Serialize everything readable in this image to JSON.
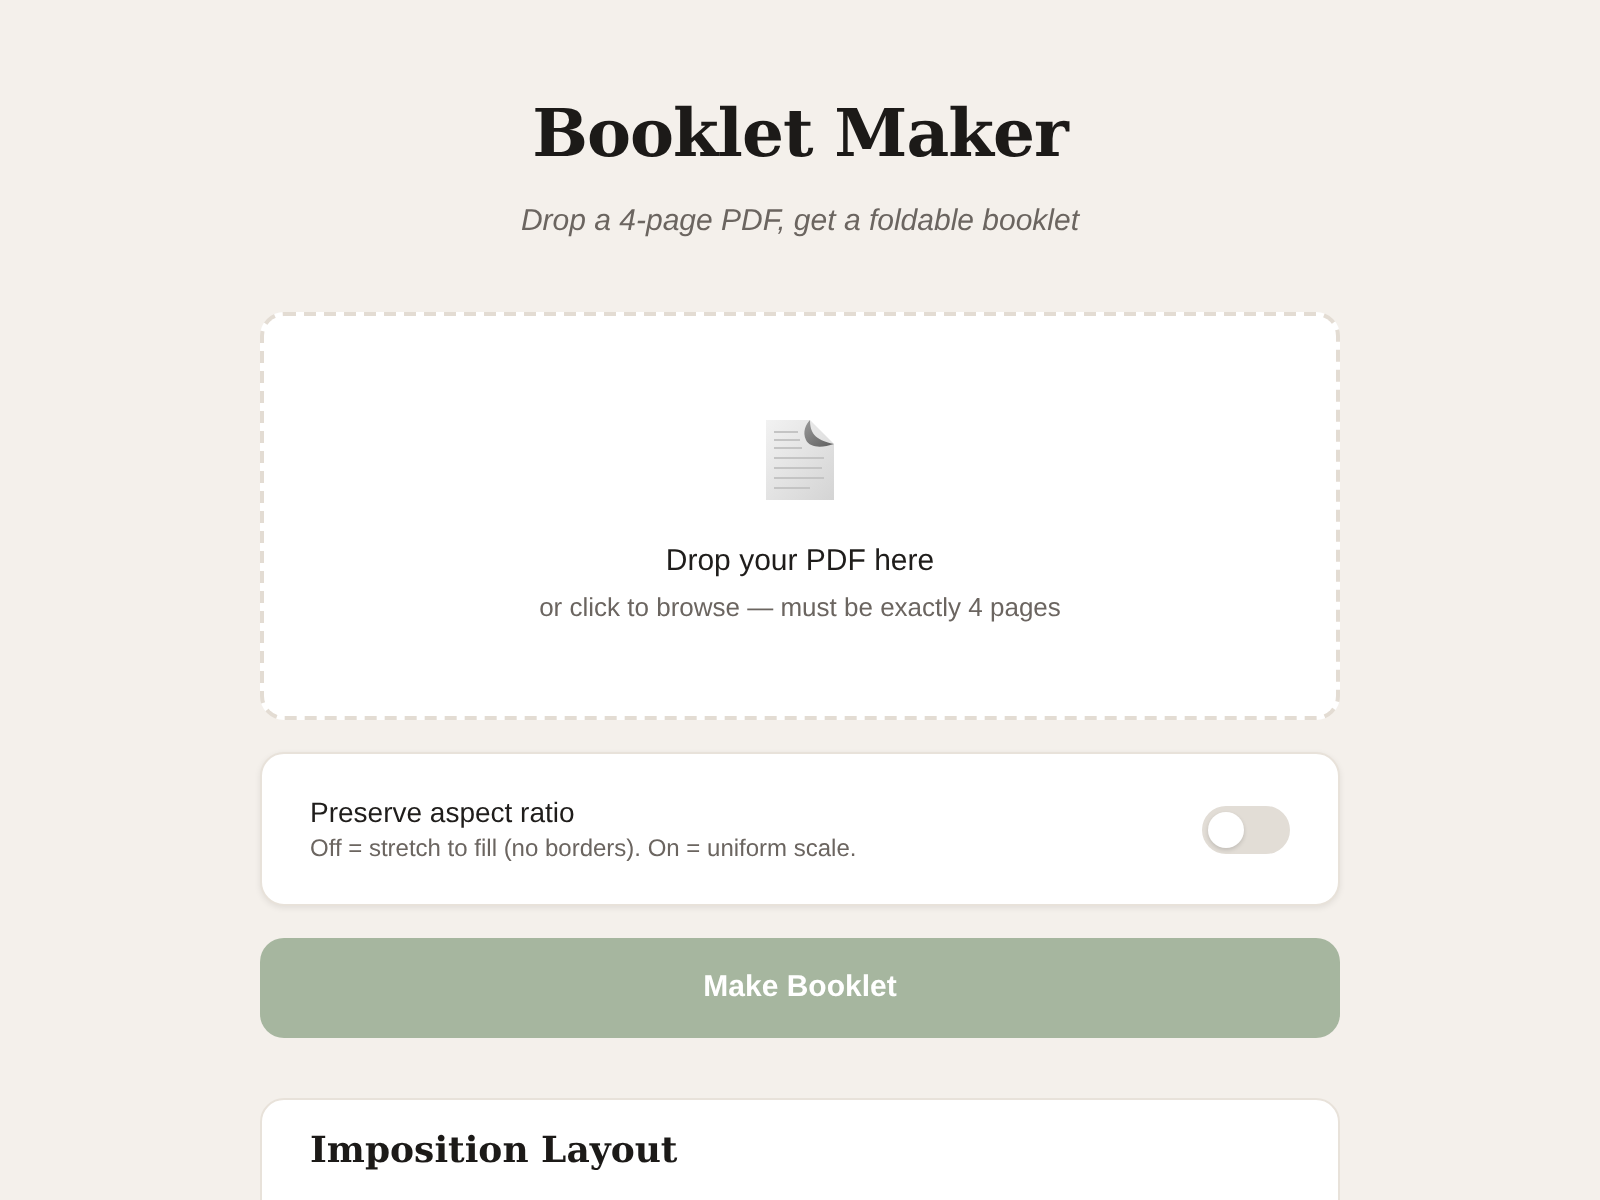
{
  "header": {
    "title": "Booklet Maker",
    "subtitle": "Drop a 4-page PDF, get a foldable booklet"
  },
  "dropzone": {
    "title": "Drop your PDF here",
    "hint": "or click to browse — must be exactly 4 pages"
  },
  "option": {
    "label": "Preserve aspect ratio",
    "description": "Off = stretch to fill (no borders). On = uniform scale.",
    "on": false
  },
  "action": {
    "label": "Make Booklet"
  },
  "layout_card": {
    "title": "Imposition Layout"
  }
}
